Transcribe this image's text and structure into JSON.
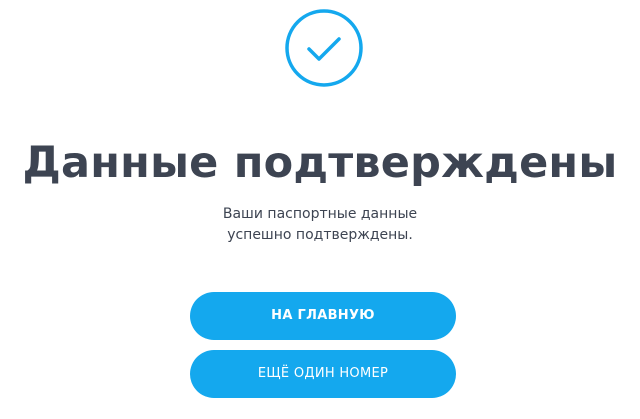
{
  "status": {
    "icon": "check-circle-icon",
    "accent_color": "#14a8ee"
  },
  "title": "Данные подтверждены",
  "subtitle": {
    "line1": "Ваши паспортные данные",
    "line2": "успешно подтверждены."
  },
  "buttons": {
    "home_label": "НА ГЛАВНУЮ",
    "another_number_label": "ЕЩЁ ОДИН НОМЕР"
  },
  "colors": {
    "text": "#3d4452",
    "button_bg": "#14a8ee",
    "button_text": "#ffffff"
  }
}
